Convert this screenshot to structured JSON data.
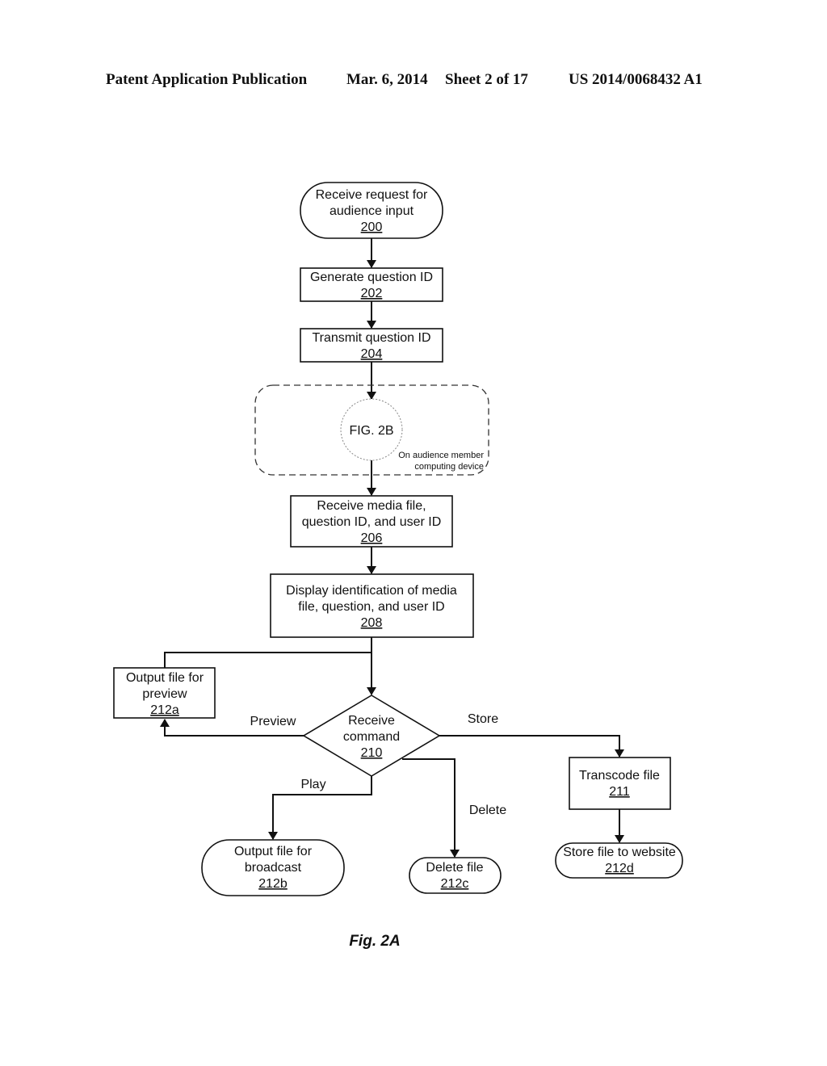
{
  "header": {
    "left": "Patent Application Publication",
    "date": "Mar. 6, 2014",
    "sheet": "Sheet 2 of 17",
    "number": "US 2014/0068432 A1"
  },
  "nodes": {
    "n200": {
      "lines": [
        "Receive request for",
        "audience input"
      ],
      "ref": "200",
      "shape": "terminal"
    },
    "n202": {
      "lines": [
        "Generate question ID"
      ],
      "ref": "202",
      "shape": "process"
    },
    "n204": {
      "lines": [
        "Transmit question ID"
      ],
      "ref": "204",
      "shape": "process"
    },
    "fig2b": {
      "label": "FIG. 2B",
      "note_lines": [
        "On audience member",
        "computing device"
      ],
      "shape": "connector"
    },
    "n206": {
      "lines": [
        "Receive media file,",
        "question ID, and user ID"
      ],
      "ref": "206",
      "shape": "process"
    },
    "n208": {
      "lines": [
        "Display identification of media",
        "file, question, and user ID"
      ],
      "ref": "208",
      "shape": "process"
    },
    "n210": {
      "lines": [
        "Receive",
        "command"
      ],
      "ref": "210",
      "shape": "decision"
    },
    "n211": {
      "lines": [
        "Transcode file"
      ],
      "ref": "211",
      "shape": "process"
    },
    "n212a": {
      "lines": [
        "Output file for",
        "preview"
      ],
      "ref": "212a",
      "shape": "process"
    },
    "n212b": {
      "lines": [
        "Output file for",
        "broadcast"
      ],
      "ref": "212b",
      "shape": "terminal"
    },
    "n212c": {
      "lines": [
        "Delete file"
      ],
      "ref": "212c",
      "shape": "terminal"
    },
    "n212d": {
      "lines": [
        "Store file to website"
      ],
      "ref": "212d",
      "shape": "terminal"
    }
  },
  "edge_labels": {
    "preview": "Preview",
    "store": "Store",
    "play": "Play",
    "delete": "Delete"
  },
  "caption": "Fig. 2A"
}
